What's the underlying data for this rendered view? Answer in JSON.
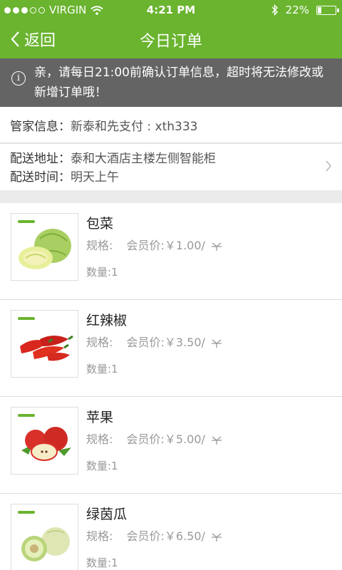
{
  "status_bar": {
    "carrier": "VIRGIN",
    "time": "4:21 PM",
    "battery": "22%",
    "battery_fraction": 0.22
  },
  "nav": {
    "back_label": "返回",
    "title": "今日订单"
  },
  "notice": {
    "text": "亲，请每日21:00前确认订单信息，超时将无法修改或新增订单哦！"
  },
  "steward": {
    "label": "管家信息：",
    "value": "新泰和先支付 : xth333"
  },
  "delivery": {
    "address_label": "配送地址：",
    "address": "泰和大酒店主楼左侧智能柜",
    "time_label": "配送时间：",
    "time": "明天上午"
  },
  "items": [
    {
      "name": "包菜",
      "spec_label": "规格:",
      "price": "会员价:￥1.00/",
      "qty": "数量:1"
    },
    {
      "name": "红辣椒",
      "spec_label": "规格:",
      "price": "会员价:￥3.50/",
      "qty": "数量:1"
    },
    {
      "name": "苹果",
      "spec_label": "规格:",
      "price": "会员价:￥5.00/",
      "qty": "数量:1"
    },
    {
      "name": "绿茵瓜",
      "spec_label": "规格:",
      "price": "会员价:￥6.50/",
      "qty": "数量:1"
    }
  ],
  "colors": {
    "accent": "#6ab42f",
    "notice_bg": "#646464"
  }
}
